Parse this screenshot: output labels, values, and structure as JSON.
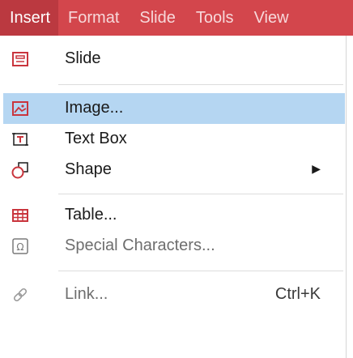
{
  "menubar": {
    "items": [
      {
        "label": "Insert"
      },
      {
        "label": "Format"
      },
      {
        "label": "Slide"
      },
      {
        "label": "Tools"
      },
      {
        "label": "View"
      }
    ],
    "active_index": 0,
    "colors": {
      "bar": "#d3464c",
      "active": "#bb3940"
    }
  },
  "insert_menu": {
    "items": [
      {
        "label": "Slide",
        "icon": "slide-icon",
        "enabled": true
      },
      {
        "label": "Image...",
        "icon": "image-icon",
        "enabled": true,
        "highlighted": true
      },
      {
        "label": "Text Box",
        "icon": "text-box-icon",
        "enabled": true
      },
      {
        "label": "Shape",
        "icon": "shape-icon",
        "enabled": true,
        "submenu": true
      },
      {
        "label": "Table...",
        "icon": "table-icon",
        "enabled": true
      },
      {
        "label": "Special Characters...",
        "icon": "special-characters-icon",
        "enabled": false
      },
      {
        "label": "Link...",
        "icon": "link-icon",
        "enabled": false,
        "shortcut": "Ctrl+K"
      }
    ],
    "colors": {
      "highlight": "#b5d6f2",
      "icon_red": "#c9353d"
    }
  }
}
